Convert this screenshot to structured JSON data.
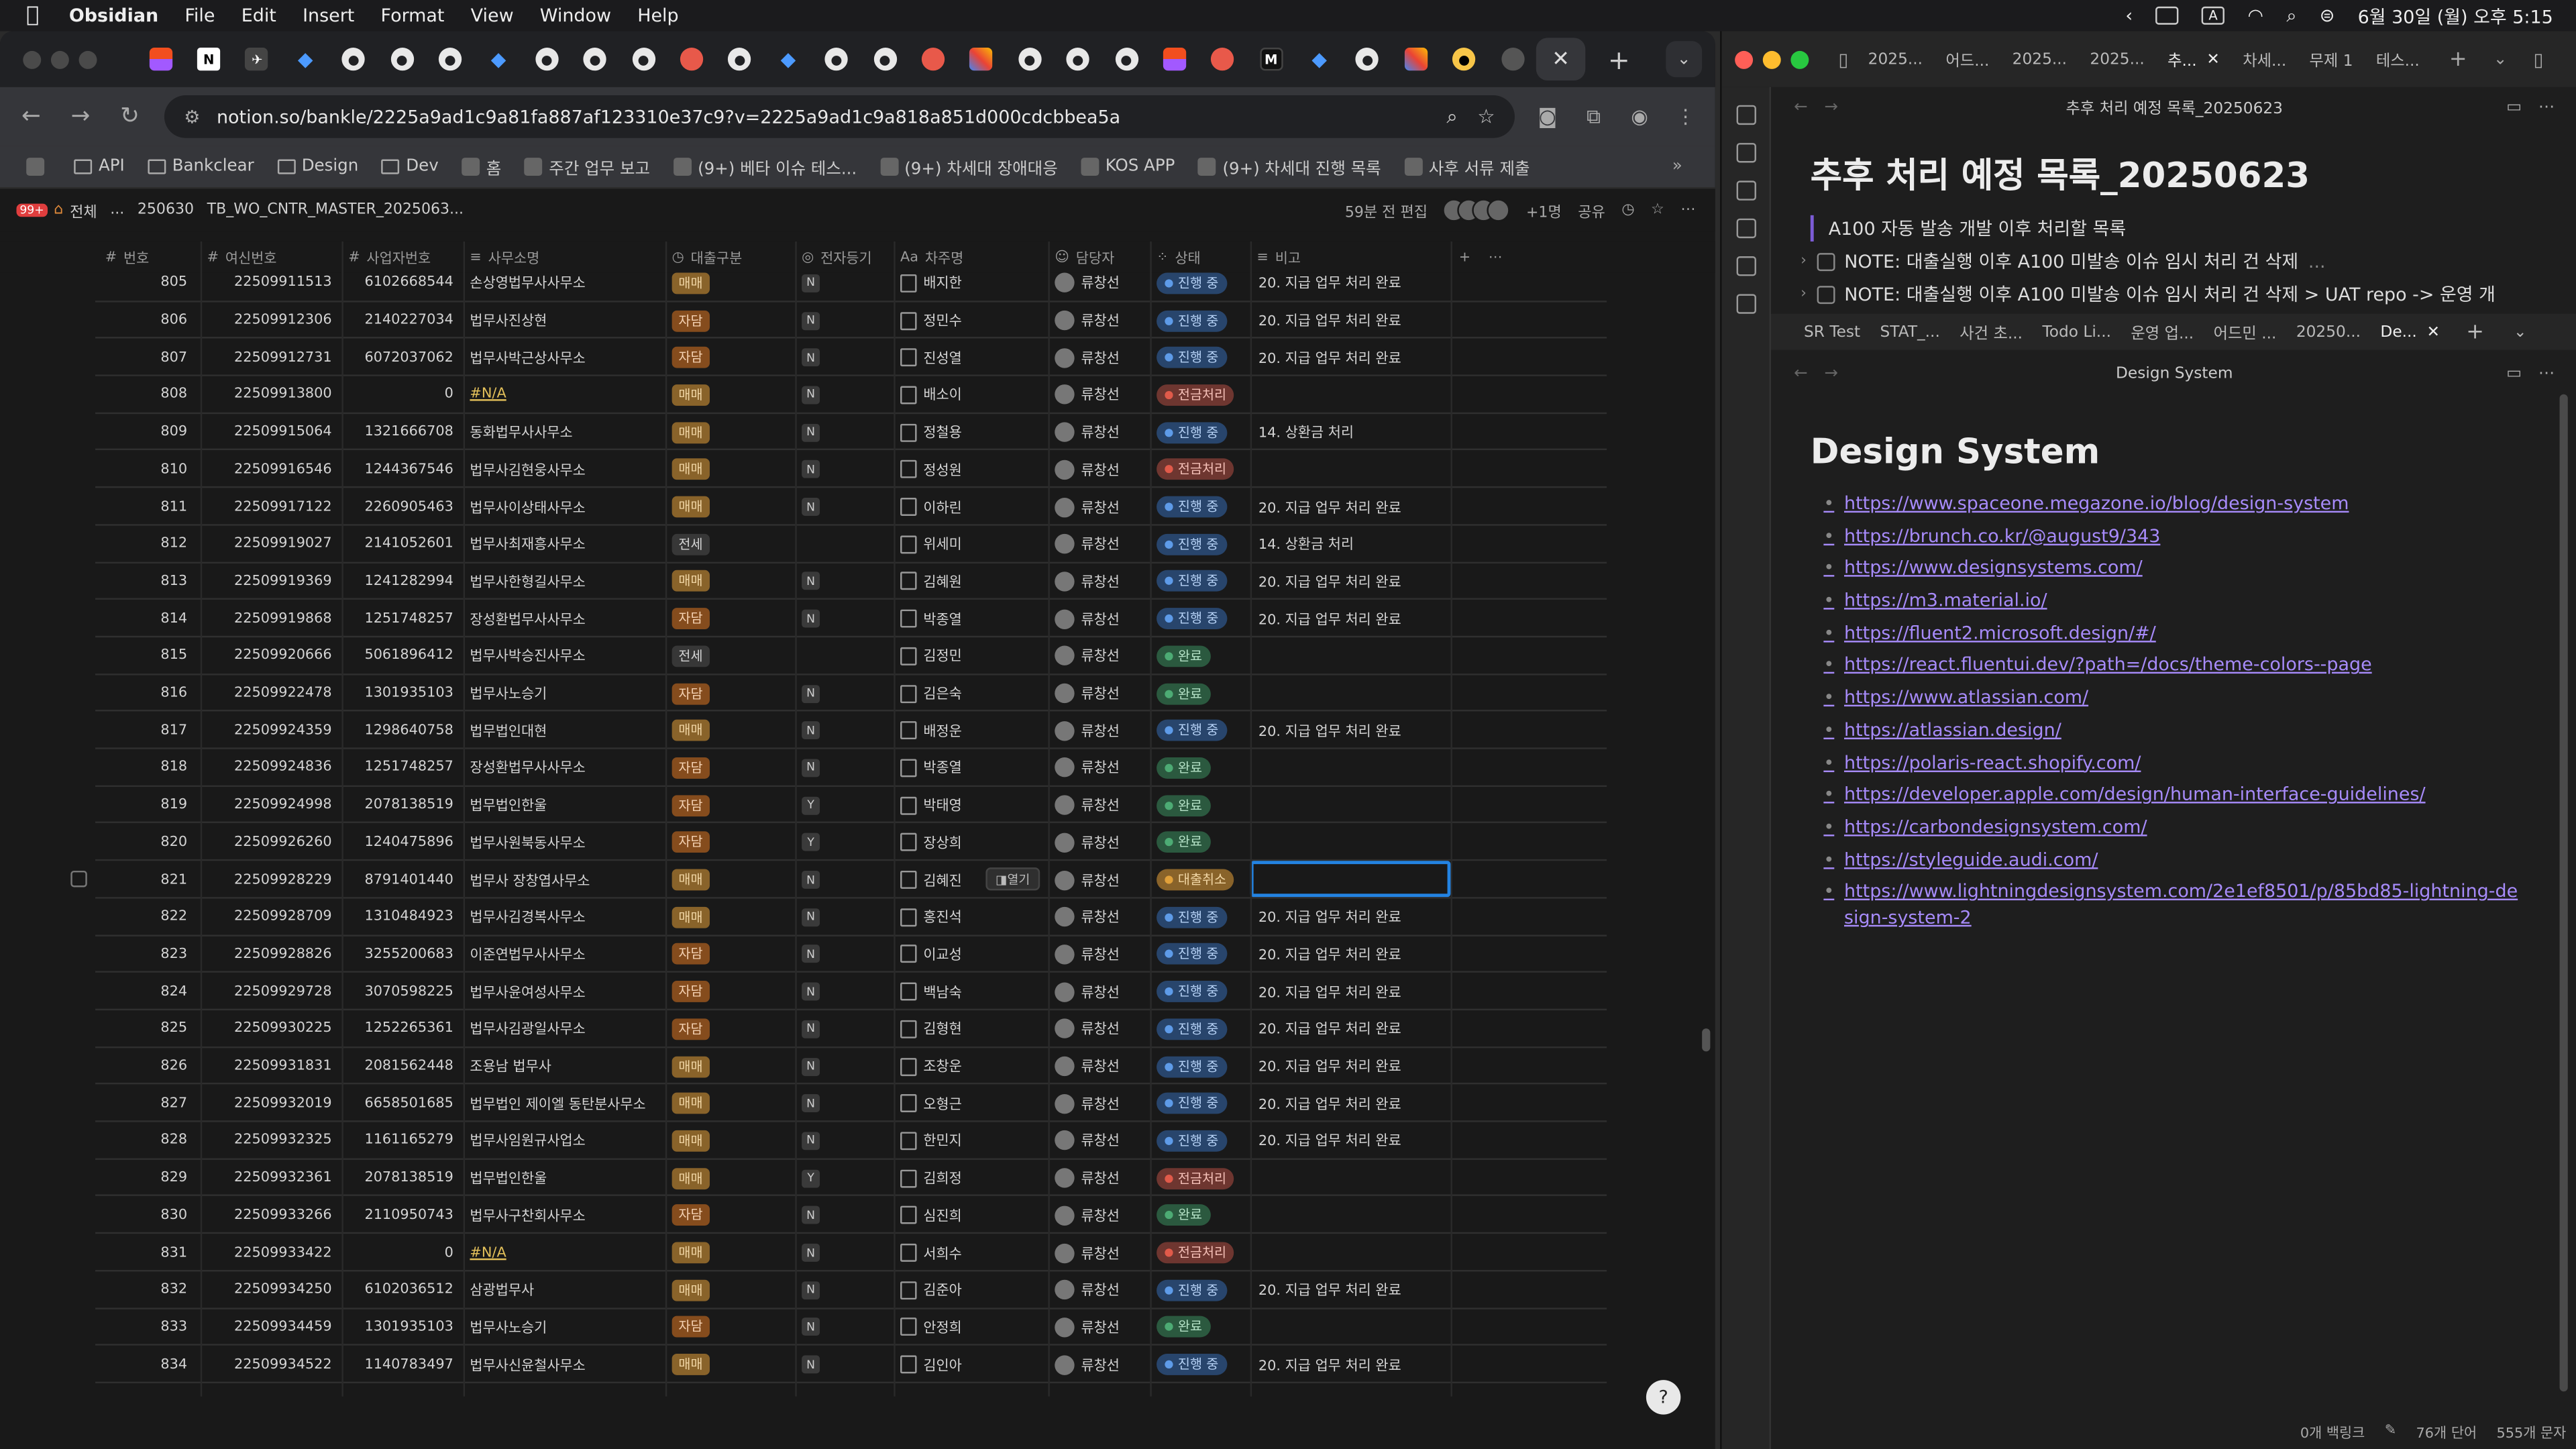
{
  "menubar": {
    "app": "Obsidian",
    "items": [
      "File",
      "Edit",
      "Insert",
      "Format",
      "View",
      "Window",
      "Help"
    ],
    "input_source": "A",
    "datetime": "6월 30일 (월) 오후 5:15"
  },
  "browser": {
    "url": "notion.so/bankle/2225a9ad1c9a81fa887af123310e37c9?v=2225a9ad1c9a818a851d000cdcbbea5a",
    "tabs": [
      "figma",
      "notion",
      "plane",
      "jira",
      "github",
      "github",
      "github",
      "jira",
      "github",
      "github",
      "github",
      "red",
      "github",
      "jira",
      "github",
      "github",
      "red",
      "multi",
      "github",
      "github",
      "github",
      "figma",
      "red",
      "mk",
      "jira",
      "github",
      "multi",
      "yellow",
      "globe",
      "active"
    ],
    "bookmarks": [
      {
        "icon": "grid",
        "label": ""
      },
      {
        "icon": "folder",
        "label": "API"
      },
      {
        "icon": "folder",
        "label": "Bankclear"
      },
      {
        "icon": "folder",
        "label": "Design"
      },
      {
        "icon": "folder",
        "label": "Dev"
      },
      {
        "icon": "app",
        "label": "홈"
      },
      {
        "icon": "app",
        "label": "주간 업무 보고"
      },
      {
        "icon": "app",
        "label": "(9+) 베타 이슈 테스..."
      },
      {
        "icon": "app",
        "label": "(9+) 차세대 장애대응"
      },
      {
        "icon": "app",
        "label": "KOS APP"
      },
      {
        "icon": "app",
        "label": "(9+) 차세대 진행 목록"
      },
      {
        "icon": "app",
        "label": "사후 서류 제출"
      }
    ]
  },
  "notion": {
    "badge": "99+",
    "breadcrumbs": [
      "전체",
      "...",
      "250630",
      "TB_WO_CNTR_MASTER_2025063..."
    ],
    "edited": "59분 전 편집",
    "extra_users": "+1명",
    "share": "공유",
    "columns": [
      "번호",
      "여신번호",
      "사업자번호",
      "사무소명",
      "대출구분",
      "전자등기",
      "차주명",
      "담당자",
      "상태",
      "비고"
    ],
    "open_label": "열기",
    "rows": [
      {
        "no": "805",
        "loan": "22509911513",
        "biz": "6102668544",
        "office": "손상영법무사사무소",
        "type": "매매",
        "e": "N",
        "borrower": "배지한",
        "mgr": "류창선",
        "status": "진행 중",
        "note": "20. 지급 업무 처리 완료"
      },
      {
        "no": "806",
        "loan": "22509912306",
        "biz": "2140227034",
        "office": "법무사진상현",
        "type": "자담",
        "e": "N",
        "borrower": "정민수",
        "mgr": "류창선",
        "status": "진행 중",
        "note": "20. 지급 업무 처리 완료"
      },
      {
        "no": "807",
        "loan": "22509912731",
        "biz": "6072037062",
        "office": "법무사박근상사무소",
        "type": "자담",
        "e": "N",
        "borrower": "진성열",
        "mgr": "류창선",
        "status": "진행 중",
        "note": "20. 지급 업무 처리 완료"
      },
      {
        "no": "808",
        "loan": "22509913800",
        "biz": "0",
        "office": "#N/A",
        "type": "매매",
        "e": "N",
        "borrower": "배소이",
        "mgr": "류창선",
        "status": "전금처리",
        "note": ""
      },
      {
        "no": "809",
        "loan": "22509915064",
        "biz": "1321666708",
        "office": "동화법무사사무소",
        "type": "매매",
        "e": "N",
        "borrower": "정철용",
        "mgr": "류창선",
        "status": "진행 중",
        "note": "14. 상환금 처리"
      },
      {
        "no": "810",
        "loan": "22509916546",
        "biz": "1244367546",
        "office": "법무사김현웅사무소",
        "type": "매매",
        "e": "N",
        "borrower": "정성원",
        "mgr": "류창선",
        "status": "전금처리",
        "note": ""
      },
      {
        "no": "811",
        "loan": "22509917122",
        "biz": "2260905463",
        "office": "법무사이상태사무소",
        "type": "매매",
        "e": "N",
        "borrower": "이하린",
        "mgr": "류창선",
        "status": "진행 중",
        "note": "20. 지급 업무 처리 완료"
      },
      {
        "no": "812",
        "loan": "22509919027",
        "biz": "2141052601",
        "office": "법무사최재흥사무소",
        "type": "전세",
        "e": "",
        "borrower": "위세미",
        "mgr": "류창선",
        "status": "진행 중",
        "note": "14. 상환금 처리"
      },
      {
        "no": "813",
        "loan": "22509919369",
        "biz": "1241282994",
        "office": "법무사한형길사무소",
        "type": "매매",
        "e": "N",
        "borrower": "김혜원",
        "mgr": "류창선",
        "status": "진행 중",
        "note": "20. 지급 업무 처리 완료"
      },
      {
        "no": "814",
        "loan": "22509919868",
        "biz": "1251748257",
        "office": "장성환법무사사무소",
        "type": "자담",
        "e": "N",
        "borrower": "박종열",
        "mgr": "류창선",
        "status": "진행 중",
        "note": "20. 지급 업무 처리 완료"
      },
      {
        "no": "815",
        "loan": "22509920666",
        "biz": "5061896412",
        "office": "법무사박승진사무소",
        "type": "전세",
        "e": "",
        "borrower": "김정민",
        "mgr": "류창선",
        "status": "완료",
        "note": ""
      },
      {
        "no": "816",
        "loan": "22509922478",
        "biz": "1301935103",
        "office": "법무사노승기",
        "type": "자담",
        "e": "N",
        "borrower": "김은숙",
        "mgr": "류창선",
        "status": "완료",
        "note": ""
      },
      {
        "no": "817",
        "loan": "22509924359",
        "biz": "1298640758",
        "office": "법무법인대현",
        "type": "매매",
        "e": "N",
        "borrower": "배정운",
        "mgr": "류창선",
        "status": "진행 중",
        "note": "20. 지급 업무 처리 완료"
      },
      {
        "no": "818",
        "loan": "22509924836",
        "biz": "1251748257",
        "office": "장성환법무사사무소",
        "type": "자담",
        "e": "N",
        "borrower": "박종열",
        "mgr": "류창선",
        "status": "완료",
        "note": ""
      },
      {
        "no": "819",
        "loan": "22509924998",
        "biz": "2078138519",
        "office": "법무법인한울",
        "type": "자담",
        "e": "Y",
        "borrower": "박태영",
        "mgr": "류창선",
        "status": "완료",
        "note": ""
      },
      {
        "no": "820",
        "loan": "22509926260",
        "biz": "1240475896",
        "office": "법무사원북동사무소",
        "type": "자담",
        "e": "Y",
        "borrower": "장상희",
        "mgr": "류창선",
        "status": "완료",
        "note": ""
      },
      {
        "no": "821",
        "loan": "22509928229",
        "biz": "8791401440",
        "office": "법무사 장창엽사무소",
        "type": "매매",
        "e": "N",
        "borrower": "김혜진",
        "mgr": "류창선",
        "status": "대출취소",
        "note": ""
      },
      {
        "no": "822",
        "loan": "22509928709",
        "biz": "1310484923",
        "office": "법무사김경복사무소",
        "type": "매매",
        "e": "N",
        "borrower": "홍진석",
        "mgr": "류창선",
        "status": "진행 중",
        "note": "20. 지급 업무 처리 완료"
      },
      {
        "no": "823",
        "loan": "22509928826",
        "biz": "3255200683",
        "office": "이준연법무사사무소",
        "type": "자담",
        "e": "N",
        "borrower": "이교성",
        "mgr": "류창선",
        "status": "진행 중",
        "note": "20. 지급 업무 처리 완료"
      },
      {
        "no": "824",
        "loan": "22509929728",
        "biz": "3070598225",
        "office": "법무사윤여성사무소",
        "type": "자담",
        "e": "N",
        "borrower": "백남숙",
        "mgr": "류창선",
        "status": "진행 중",
        "note": "20. 지급 업무 처리 완료"
      },
      {
        "no": "825",
        "loan": "22509930225",
        "biz": "1252265361",
        "office": "법무사김광일사무소",
        "type": "자담",
        "e": "N",
        "borrower": "김형현",
        "mgr": "류창선",
        "status": "진행 중",
        "note": "20. 지급 업무 처리 완료"
      },
      {
        "no": "826",
        "loan": "22509931831",
        "biz": "2081562448",
        "office": "조용남 법무사",
        "type": "매매",
        "e": "N",
        "borrower": "조창운",
        "mgr": "류창선",
        "status": "진행 중",
        "note": "20. 지급 업무 처리 완료"
      },
      {
        "no": "827",
        "loan": "22509932019",
        "biz": "6658501685",
        "office": "법무법인 제이엘 동탄분사무소",
        "type": "매매",
        "e": "N",
        "borrower": "오형근",
        "mgr": "류창선",
        "status": "진행 중",
        "note": "20. 지급 업무 처리 완료"
      },
      {
        "no": "828",
        "loan": "22509932325",
        "biz": "1161165279",
        "office": "법무사임원규사업소",
        "type": "매매",
        "e": "N",
        "borrower": "한민지",
        "mgr": "류창선",
        "status": "진행 중",
        "note": "20. 지급 업무 처리 완료"
      },
      {
        "no": "829",
        "loan": "22509932361",
        "biz": "2078138519",
        "office": "법무법인한울",
        "type": "매매",
        "e": "Y",
        "borrower": "김희정",
        "mgr": "류창선",
        "status": "전금처리",
        "note": ""
      },
      {
        "no": "830",
        "loan": "22509933266",
        "biz": "2110950743",
        "office": "법무사구찬회사무소",
        "type": "자담",
        "e": "N",
        "borrower": "심진희",
        "mgr": "류창선",
        "status": "완료",
        "note": ""
      },
      {
        "no": "831",
        "loan": "22509933422",
        "biz": "0",
        "office": "#N/A",
        "type": "매매",
        "e": "N",
        "borrower": "서희수",
        "mgr": "류창선",
        "status": "전금처리",
        "note": ""
      },
      {
        "no": "832",
        "loan": "22509934250",
        "biz": "6102036512",
        "office": "삼광법무사",
        "type": "매매",
        "e": "N",
        "borrower": "김준아",
        "mgr": "류창선",
        "status": "진행 중",
        "note": "20. 지급 업무 처리 완료"
      },
      {
        "no": "833",
        "loan": "22509934459",
        "biz": "1301935103",
        "office": "법무사노승기",
        "type": "자담",
        "e": "N",
        "borrower": "안정희",
        "mgr": "류창선",
        "status": "완료",
        "note": ""
      },
      {
        "no": "834",
        "loan": "22509934522",
        "biz": "1140783497",
        "office": "법무사신윤철사무소",
        "type": "매매",
        "e": "N",
        "borrower": "김인아",
        "mgr": "류창선",
        "status": "진행 중",
        "note": "20. 지급 업무 처리 완료"
      }
    ]
  },
  "obsidian": {
    "top_tabs": [
      "2025...",
      "어드...",
      "2025...",
      "2025...",
      "추...",
      "차세...",
      "무제 1",
      "테스..."
    ],
    "pane1": {
      "title": "추후 처리 예정 목록_20250623",
      "heading": "추후 처리 예정 목록_20250623",
      "quote": "A100 자동 발송 개발 이후 처리할 목록",
      "tasks": [
        "NOTE: 대출실행 이후 A100 미발송 이슈 임시 처리 건 삭제",
        "NOTE: 대출실행 이후 A100 미발송 이슈 임시 처리 건 삭제 > UAT repo -> 운영 개"
      ],
      "ellipsis": "..."
    },
    "bottom_tabs": [
      "SR Test",
      "STAT_...",
      "사건 초...",
      "Todo Li...",
      "운영 업...",
      "어드민 ...",
      "20250...",
      "De..."
    ],
    "pane2": {
      "title": "Design System",
      "heading": "Design System",
      "links": [
        "https://www.spaceone.megazone.io/blog/design-system",
        "https://brunch.co.kr/@august9/343",
        "https://www.designsystems.com/",
        "https://m3.material.io/",
        "https://fluent2.microsoft.design/#/",
        "https://react.fluentui.dev/?path=/docs/theme-colors--page",
        "https://www.atlassian.com/",
        "https://atlassian.design/",
        "https://polaris-react.shopify.com/",
        "https://developer.apple.com/design/human-interface-guidelines/",
        "https://carbondesignsystem.com/",
        "https://styleguide.audi.com/",
        "https://www.lightningdesignsystem.com/2e1ef8501/p/85bd85-lightning-design-system-2"
      ]
    },
    "status": {
      "backlinks": "0개 백링크",
      "words": "76개 단어",
      "chars": "555개 문자"
    }
  }
}
